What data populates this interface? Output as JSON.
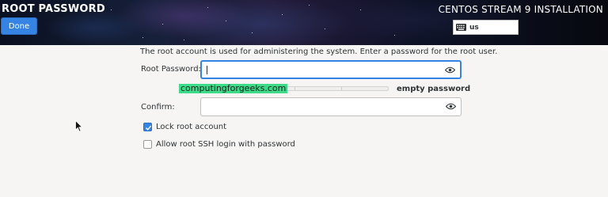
{
  "header": {
    "title": "ROOT PASSWORD",
    "done_label": "Done",
    "install_title": "CENTOS STREAM 9 INSTALLATION",
    "keyboard_layout": "us"
  },
  "form": {
    "intro": "The root account is used for administering the system.  Enter a password for the root user.",
    "root_password_label": "Root Password:",
    "root_password_value": "",
    "strength_text": "empty password",
    "watermark": "computingforgeeks.com",
    "confirm_label": "Confirm:",
    "confirm_value": "",
    "lock_root_label": "Lock root account",
    "lock_root_checked": true,
    "ssh_login_label": "Allow root SSH login with password",
    "ssh_login_checked": false
  },
  "colors": {
    "accent": "#3584e4",
    "background": "#f6f5f4",
    "watermark_bg": "#00d264"
  },
  "icons": {
    "keyboard": "keyboard-icon",
    "reveal": "eye-icon",
    "check": "checkmark-icon",
    "pointer": "mouse-pointer-icon"
  }
}
